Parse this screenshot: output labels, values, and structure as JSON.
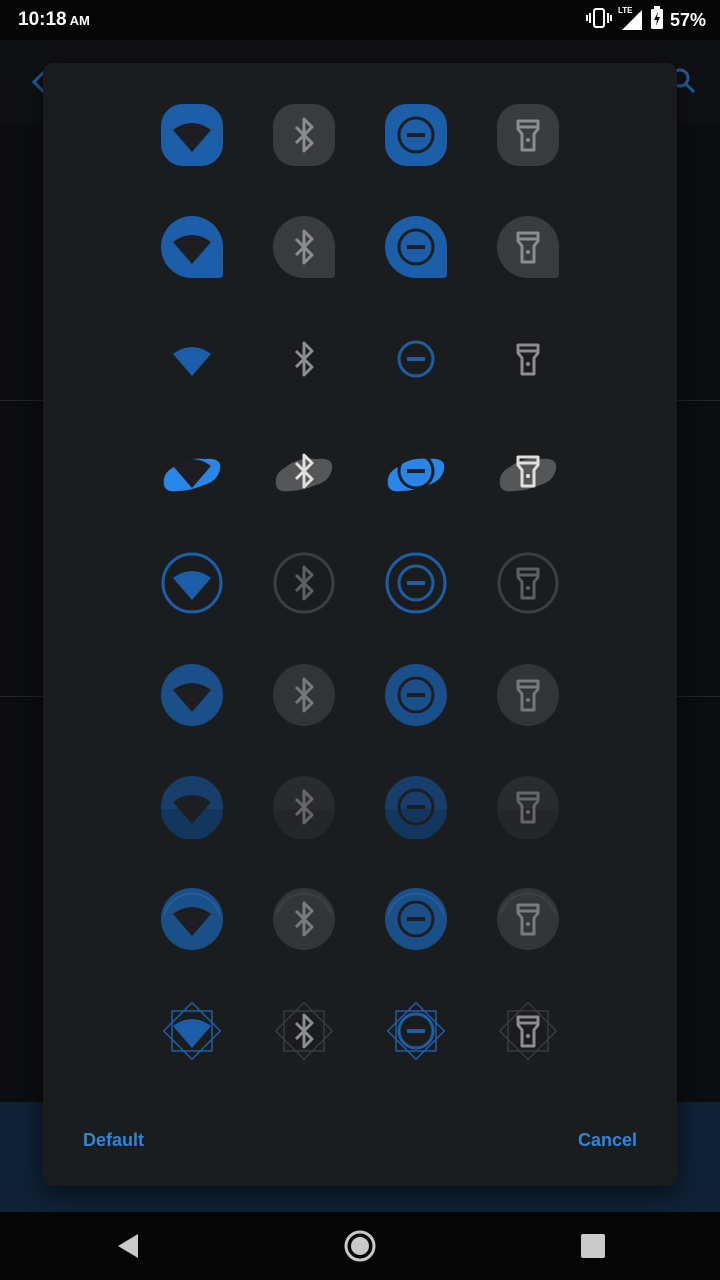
{
  "status_bar": {
    "time": "10:18",
    "ampm": "AM",
    "network": "LTE",
    "battery_percent": "57%",
    "icons": [
      "vibrate-icon",
      "signal-icon",
      "battery-charging-icon"
    ]
  },
  "colors": {
    "accent_blue": "#1c5fa8",
    "bright_blue": "#2a86e6",
    "gray_tile": "#3a3b3d",
    "gray_glyph": "#8c8d8f",
    "dialog_bg": "#1b1c1e",
    "button_text": "#2f86d6"
  },
  "dialog": {
    "tile_icons": [
      "wifi-icon",
      "bluetooth-icon",
      "do-not-disturb-icon",
      "flashlight-icon"
    ],
    "styles": [
      "squircle",
      "teardrop",
      "plain",
      "brush",
      "ring",
      "circle-gradient",
      "circle-horizon",
      "circle-bevel",
      "diamond"
    ],
    "default_label": "Default",
    "cancel_label": "Cancel"
  },
  "nav_bar": {
    "buttons": [
      "back-icon",
      "home-icon",
      "recents-icon"
    ]
  }
}
